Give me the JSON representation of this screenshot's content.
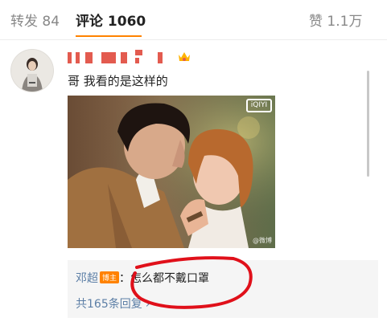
{
  "tabs": {
    "repost": "转发 84",
    "comments_label": "评论",
    "comments_count": "1060",
    "likes": "赞 1.1万"
  },
  "comment": {
    "text": "哥 我看的是这样的"
  },
  "photo": {
    "logo_text": "iQIYI",
    "watermark": "@微博"
  },
  "reply": {
    "user": "邓超",
    "badge": "博主",
    "colon": "：",
    "text": "怎么都不戴口罩",
    "count_text": "共165条回复",
    "chevron": "›"
  },
  "colors": {
    "accent": "#ff8200",
    "link": "#5d7fa6",
    "annotation": "#e0101a"
  }
}
